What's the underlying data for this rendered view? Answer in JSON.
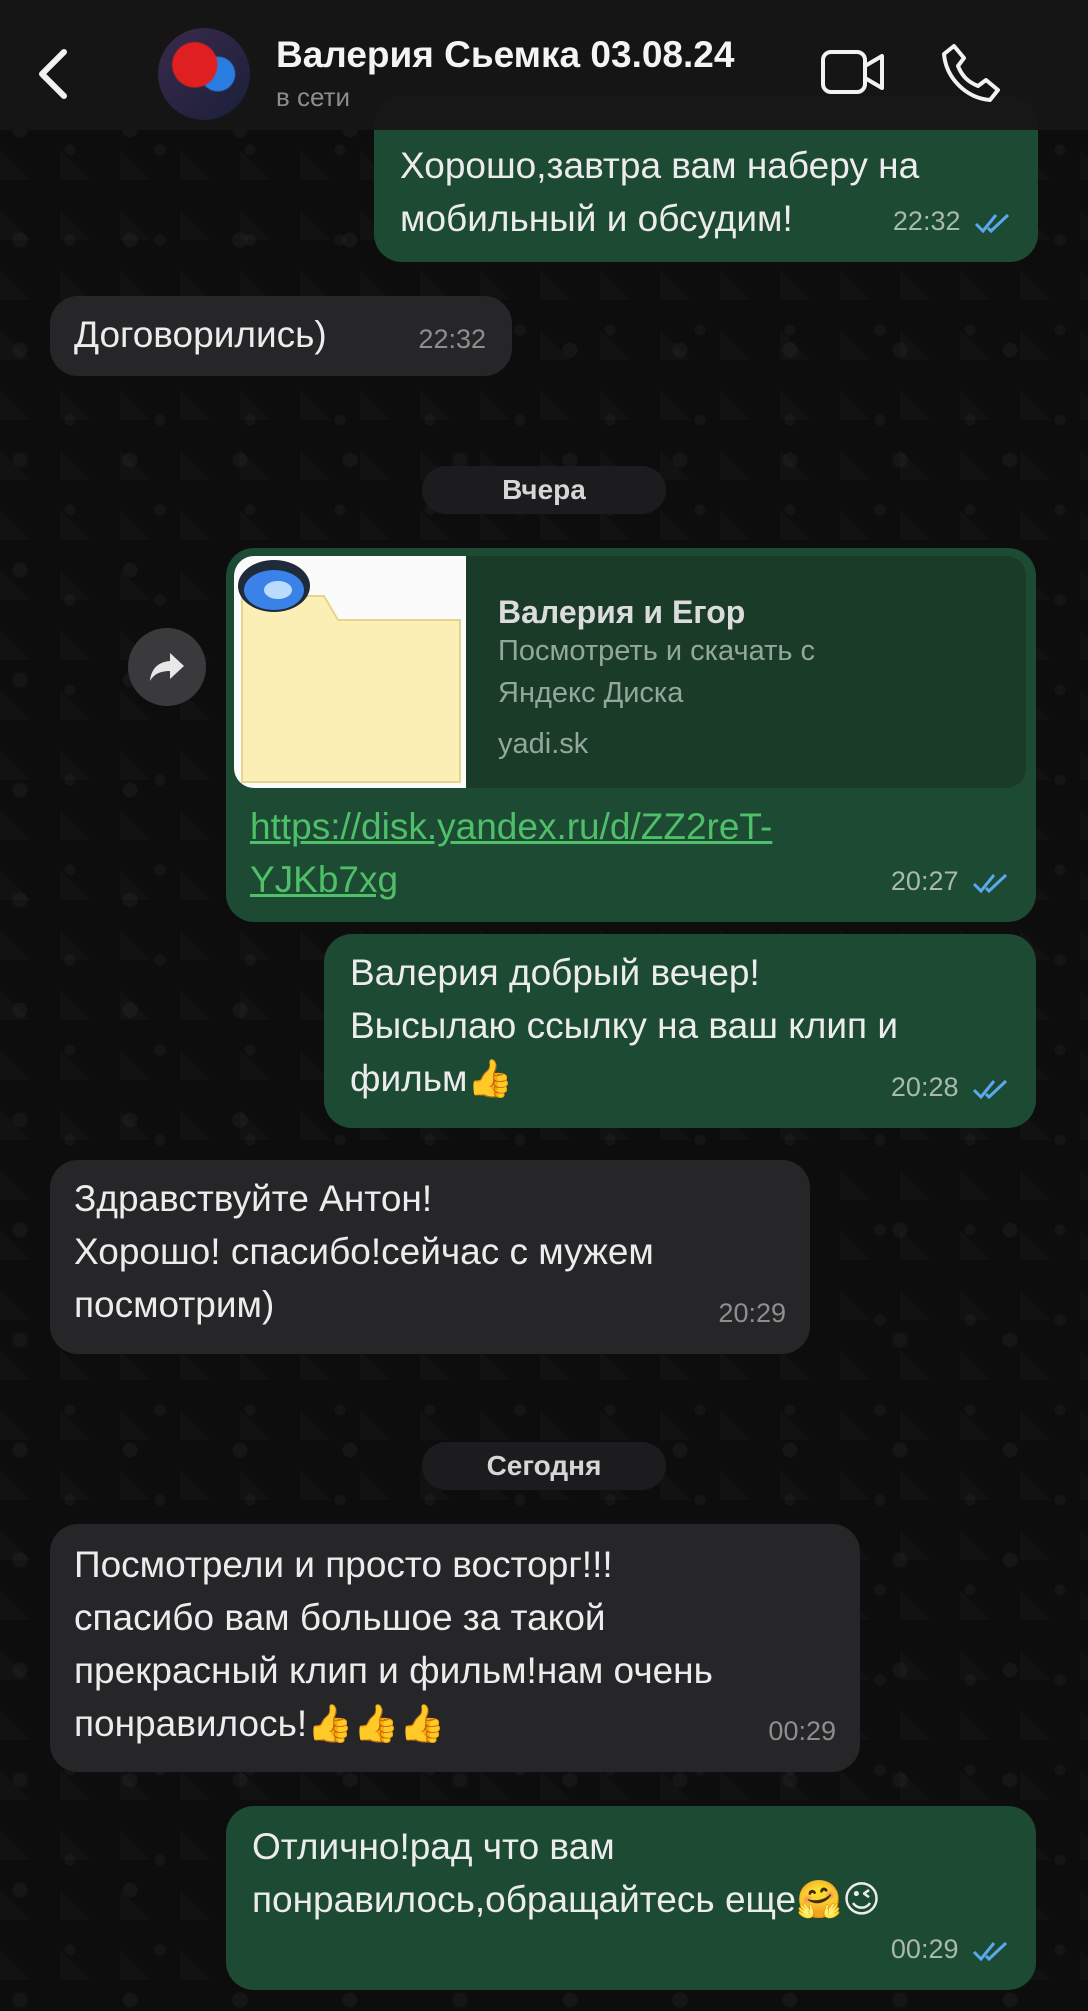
{
  "header": {
    "contact_name": "Валерия Сьемка 03.08.24",
    "status": "в сети"
  },
  "messages": [
    {
      "type": "out",
      "text": "Хорошо,завтра вам наберу на\nмобильный и обсудим!",
      "time": "22:32"
    },
    {
      "type": "in",
      "text": "Договорились)",
      "time": "22:32"
    },
    {
      "type": "out",
      "text": "Валерия добрый вечер!\nВысылаю ссылку на ваш клип и\nфильм👍",
      "time": "20:28"
    },
    {
      "type": "in",
      "text": "Здравствуйте Антон!\nХорошо! спасибо!сейчас с мужем\nпосмотрим)",
      "time": "20:29"
    },
    {
      "type": "in",
      "text": "Посмотрели и просто восторг!!!\nспасибо вам большое за такой\nпрекрасный клип и фильм!нам очень\nпонравилось!👍👍👍",
      "time": "00:29"
    },
    {
      "type": "out",
      "text": "Отлично!рад что вам\nпонравилось,обращайтесь еще🤗😉",
      "time": "00:29"
    }
  ],
  "link_message": {
    "card_title": "Валерия и Егор",
    "card_desc": "Посмотреть и скачать с\nЯндекс Диска",
    "card_domain": "yadi.sk",
    "link": "https://disk.yandex.ru/d/ZZ2reT-\nYJKb7xg",
    "time": "20:27"
  },
  "date_separators": [
    "Вчера",
    "Сегодня"
  ],
  "icons": {
    "back": "chevron-left-icon",
    "video": "video-camera-icon",
    "call": "phone-icon",
    "forward": "forward-arrow-icon",
    "read": "double-check-icon"
  },
  "colors": {
    "outgoing_bubble": "#1d4a32",
    "incoming_bubble": "#262628",
    "link": "#4fbf69",
    "read_ticks": "#5aa8ee"
  }
}
